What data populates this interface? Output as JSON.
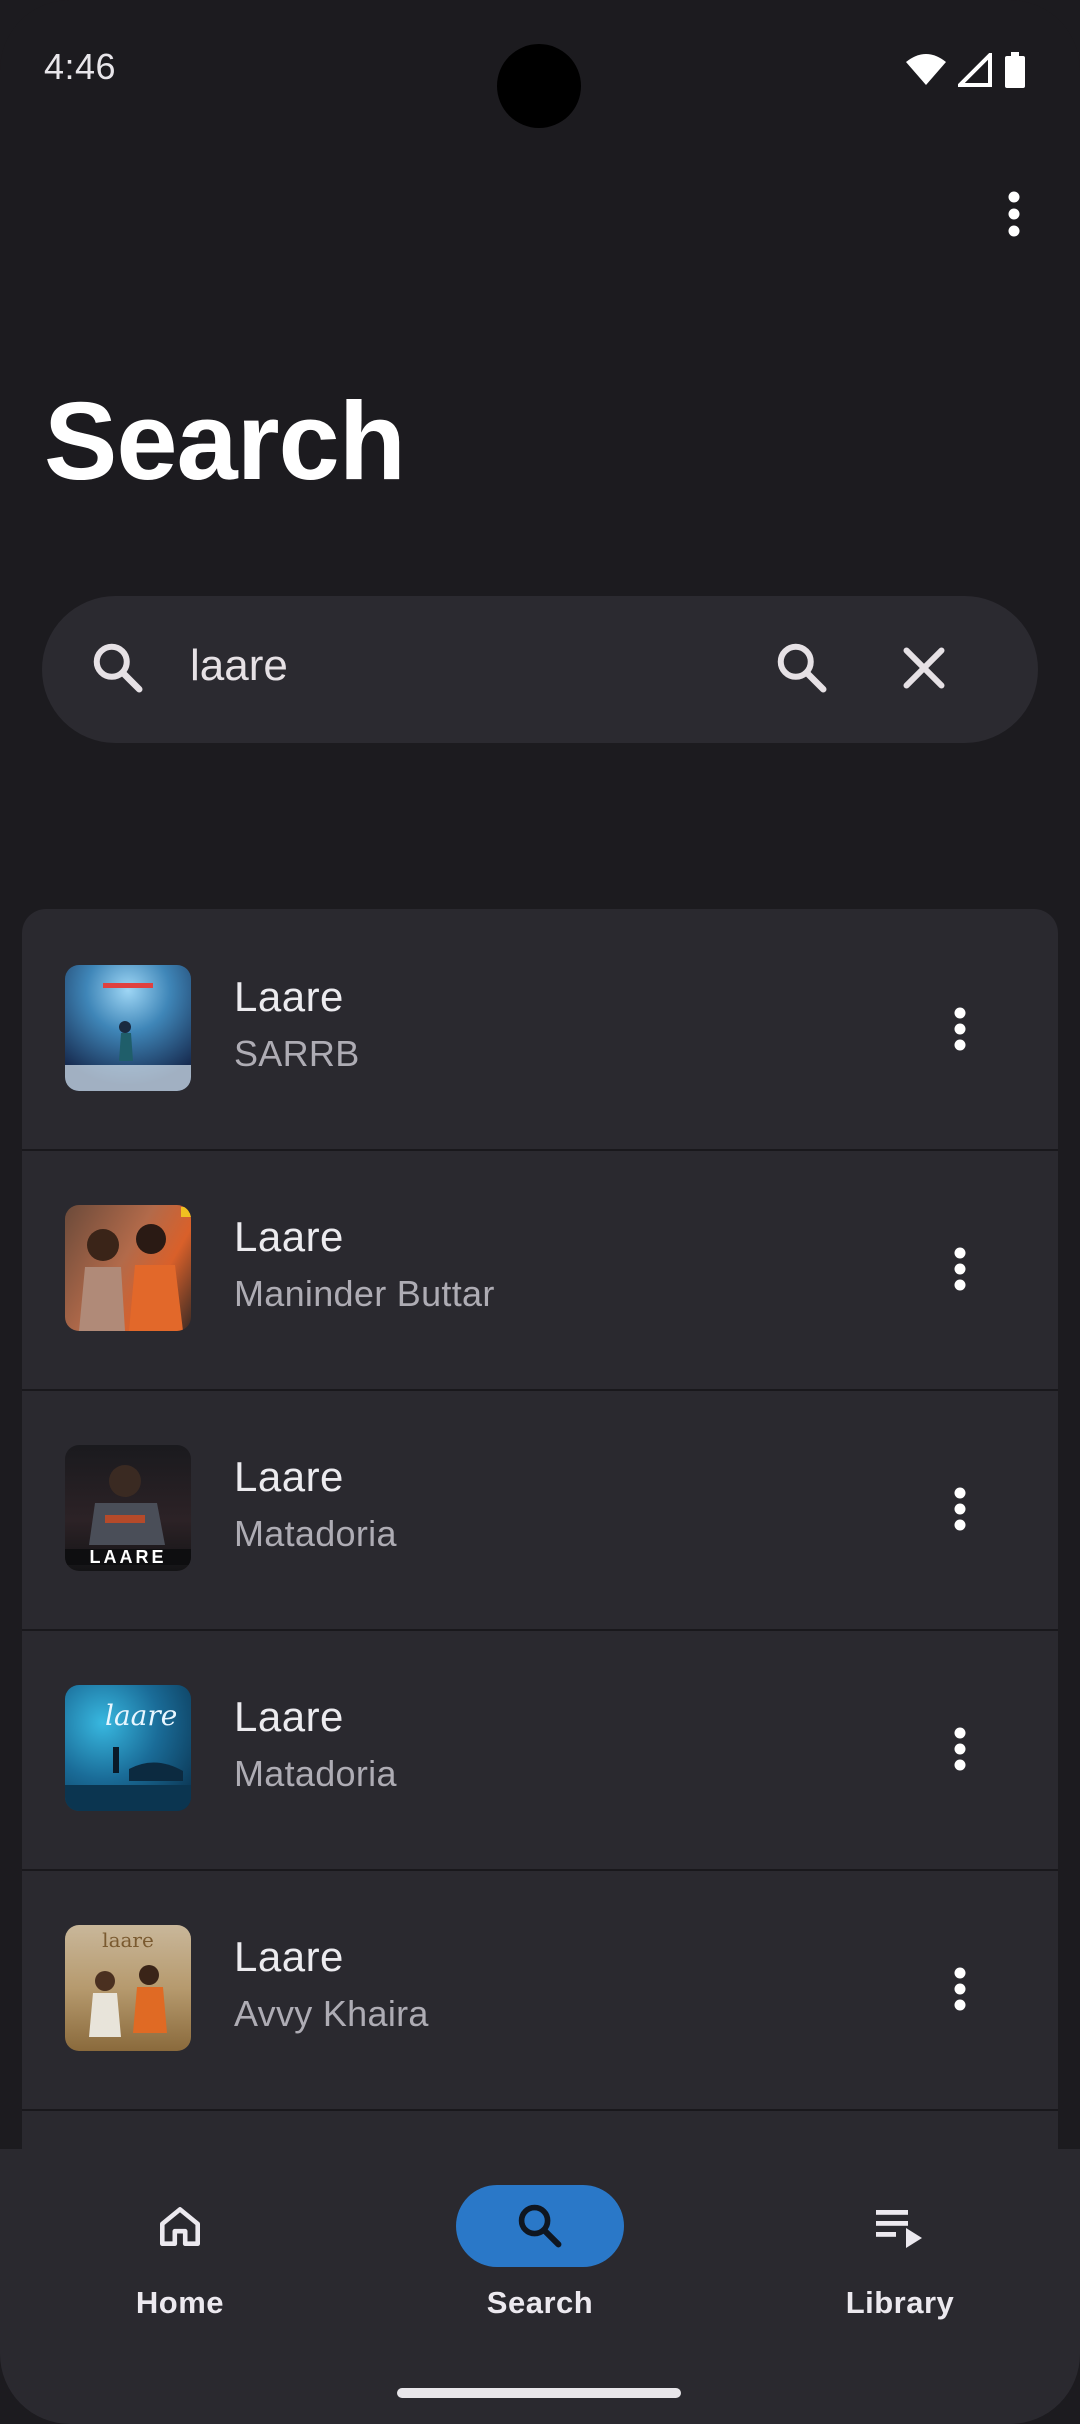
{
  "status_bar": {
    "time": "4:46"
  },
  "page": {
    "title": "Search"
  },
  "search": {
    "query": "laare"
  },
  "results": [
    {
      "title": "Laare",
      "artist": "SARRB"
    },
    {
      "title": "Laare",
      "artist": "Maninder Buttar"
    },
    {
      "title": "Laare",
      "artist": "Matadoria"
    },
    {
      "title": "Laare",
      "artist": "Matadoria"
    },
    {
      "title": "Laare",
      "artist": "Avvy Khaira"
    }
  ],
  "nav": {
    "home": "Home",
    "search": "Search",
    "library": "Library",
    "active_color": "#2a78c8"
  },
  "icons": [
    "wifi-icon",
    "signal-icon",
    "battery-icon",
    "more-vert-icon",
    "search-icon",
    "close-icon",
    "home-icon",
    "queue-music-icon"
  ]
}
